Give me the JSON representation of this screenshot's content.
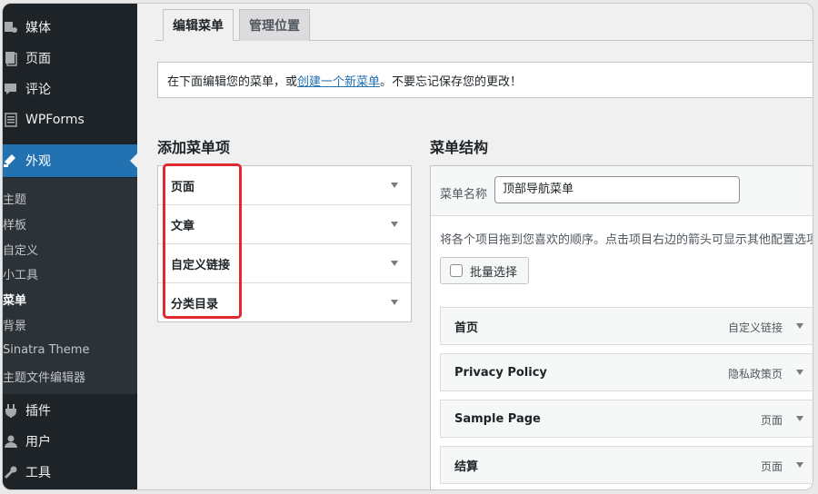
{
  "sidebar": {
    "top_items": [
      {
        "label": "媒体",
        "icon": "media-icon"
      },
      {
        "label": "页面",
        "icon": "pages-icon"
      },
      {
        "label": "评论",
        "icon": "comments-icon"
      },
      {
        "label": "WPForms",
        "icon": "wpforms-icon"
      }
    ],
    "current": {
      "label": "外观",
      "icon": "appearance-icon"
    },
    "submenu": [
      "主题",
      "样板",
      "自定义",
      "小工具",
      "菜单",
      "背景",
      "Sinatra Theme",
      "主题文件编辑器"
    ],
    "bottom_items": [
      {
        "label": "插件",
        "icon": "plugins-icon"
      },
      {
        "label": "用户",
        "icon": "users-icon"
      },
      {
        "label": "工具",
        "icon": "tools-icon"
      }
    ]
  },
  "tabs": {
    "edit": "编辑菜单",
    "locations": "管理位置"
  },
  "notice": {
    "before": "在下面编辑您的菜单，或",
    "link": "创建一个新菜单",
    "after": "。不要忘记保存您的更改！"
  },
  "add_items": {
    "title": "添加菜单项",
    "sections": [
      "页面",
      "文章",
      "自定义链接",
      "分类目录"
    ]
  },
  "structure": {
    "title": "菜单结构",
    "name_label": "菜单名称",
    "name_value": "顶部导航菜单",
    "instructions": "将各个项目拖到您喜欢的顺序。点击项目右边的箭头可显示其他配置选项",
    "bulk_select": "批量选择",
    "items": [
      {
        "title": "首页",
        "type": "自定义链接"
      },
      {
        "title": "Privacy Policy",
        "type": "隐私政策页"
      },
      {
        "title": "Sample Page",
        "type": "页面"
      },
      {
        "title": "结算",
        "type": "页面"
      }
    ]
  },
  "colors": {
    "sidebar_bg": "#1d2327",
    "submenu_bg": "#2c3338",
    "accent": "#2271b1",
    "highlight_box": "#e0282f"
  }
}
